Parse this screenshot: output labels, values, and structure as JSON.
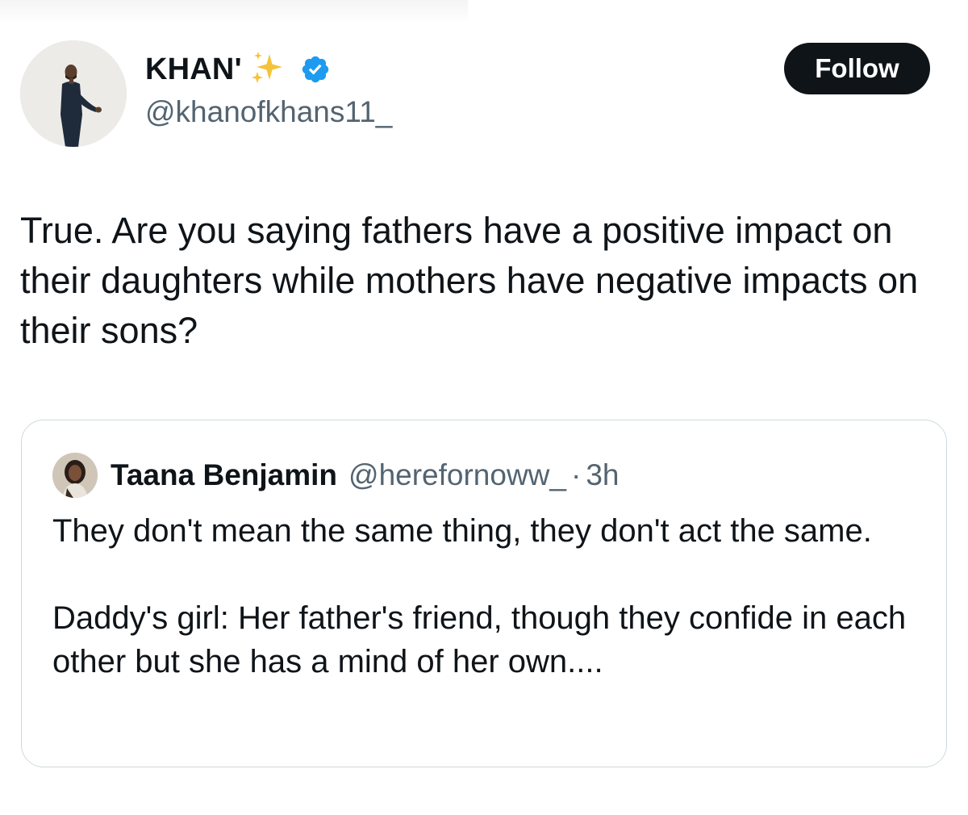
{
  "author": {
    "display_name": "KHAN'",
    "handle": "@khanofkhans11_",
    "avatar_icon": "avatar-photo-man-standing",
    "badge_icon": "verified-badge",
    "badge_color": "#1d9bf0"
  },
  "follow_label": "Follow",
  "tweet_text": "True. Are you saying fathers have a positive impact on their daughters while mothers have negative impacts on their sons?",
  "quote": {
    "display_name": "Taana Benjamin",
    "handle": "@herefornoww_",
    "separator": "·",
    "time": "3h",
    "text": "They don't mean the same thing, they don't act the same.\n\nDaddy's girl: Her father's friend, though they confide in each other but she has a mind of her own...."
  },
  "colors": {
    "text": "#0f1419",
    "secondary": "#536471",
    "border": "#cfd9de",
    "sparkle": "#f5c33b"
  }
}
